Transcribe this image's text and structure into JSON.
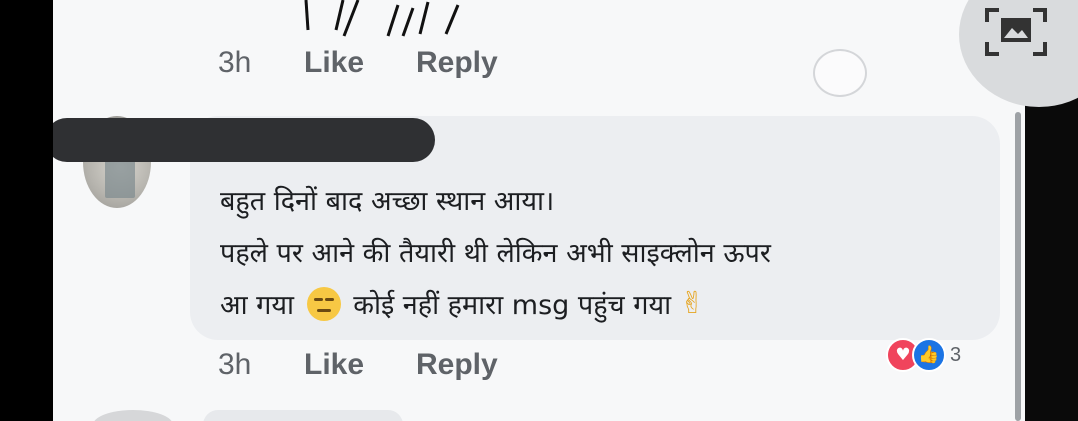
{
  "top_comment": {
    "time": "3h",
    "like_label": "Like",
    "reply_label": "Reply"
  },
  "comment": {
    "lines": [
      "बहुत दिनों बाद अच्छा स्थान आया।",
      "पहले पर आने की तैयारी थी लेकिन अभी साइक्लोन ऊपर",
      "आ गया",
      "कोई नहीं हमारा msg पहुंच गया"
    ],
    "time": "3h",
    "like_label": "Like",
    "reply_label": "Reply",
    "reaction_count": "3",
    "reactions": [
      "love",
      "like"
    ]
  },
  "icons": {
    "pip": "picture-in-picture-icon",
    "emoji1": "expressionless-face-emoji",
    "emoji2": "victory-hand-emoji"
  },
  "colors": {
    "love": "#f0445c",
    "like": "#1b74e4",
    "bubble": "#eceef1"
  }
}
